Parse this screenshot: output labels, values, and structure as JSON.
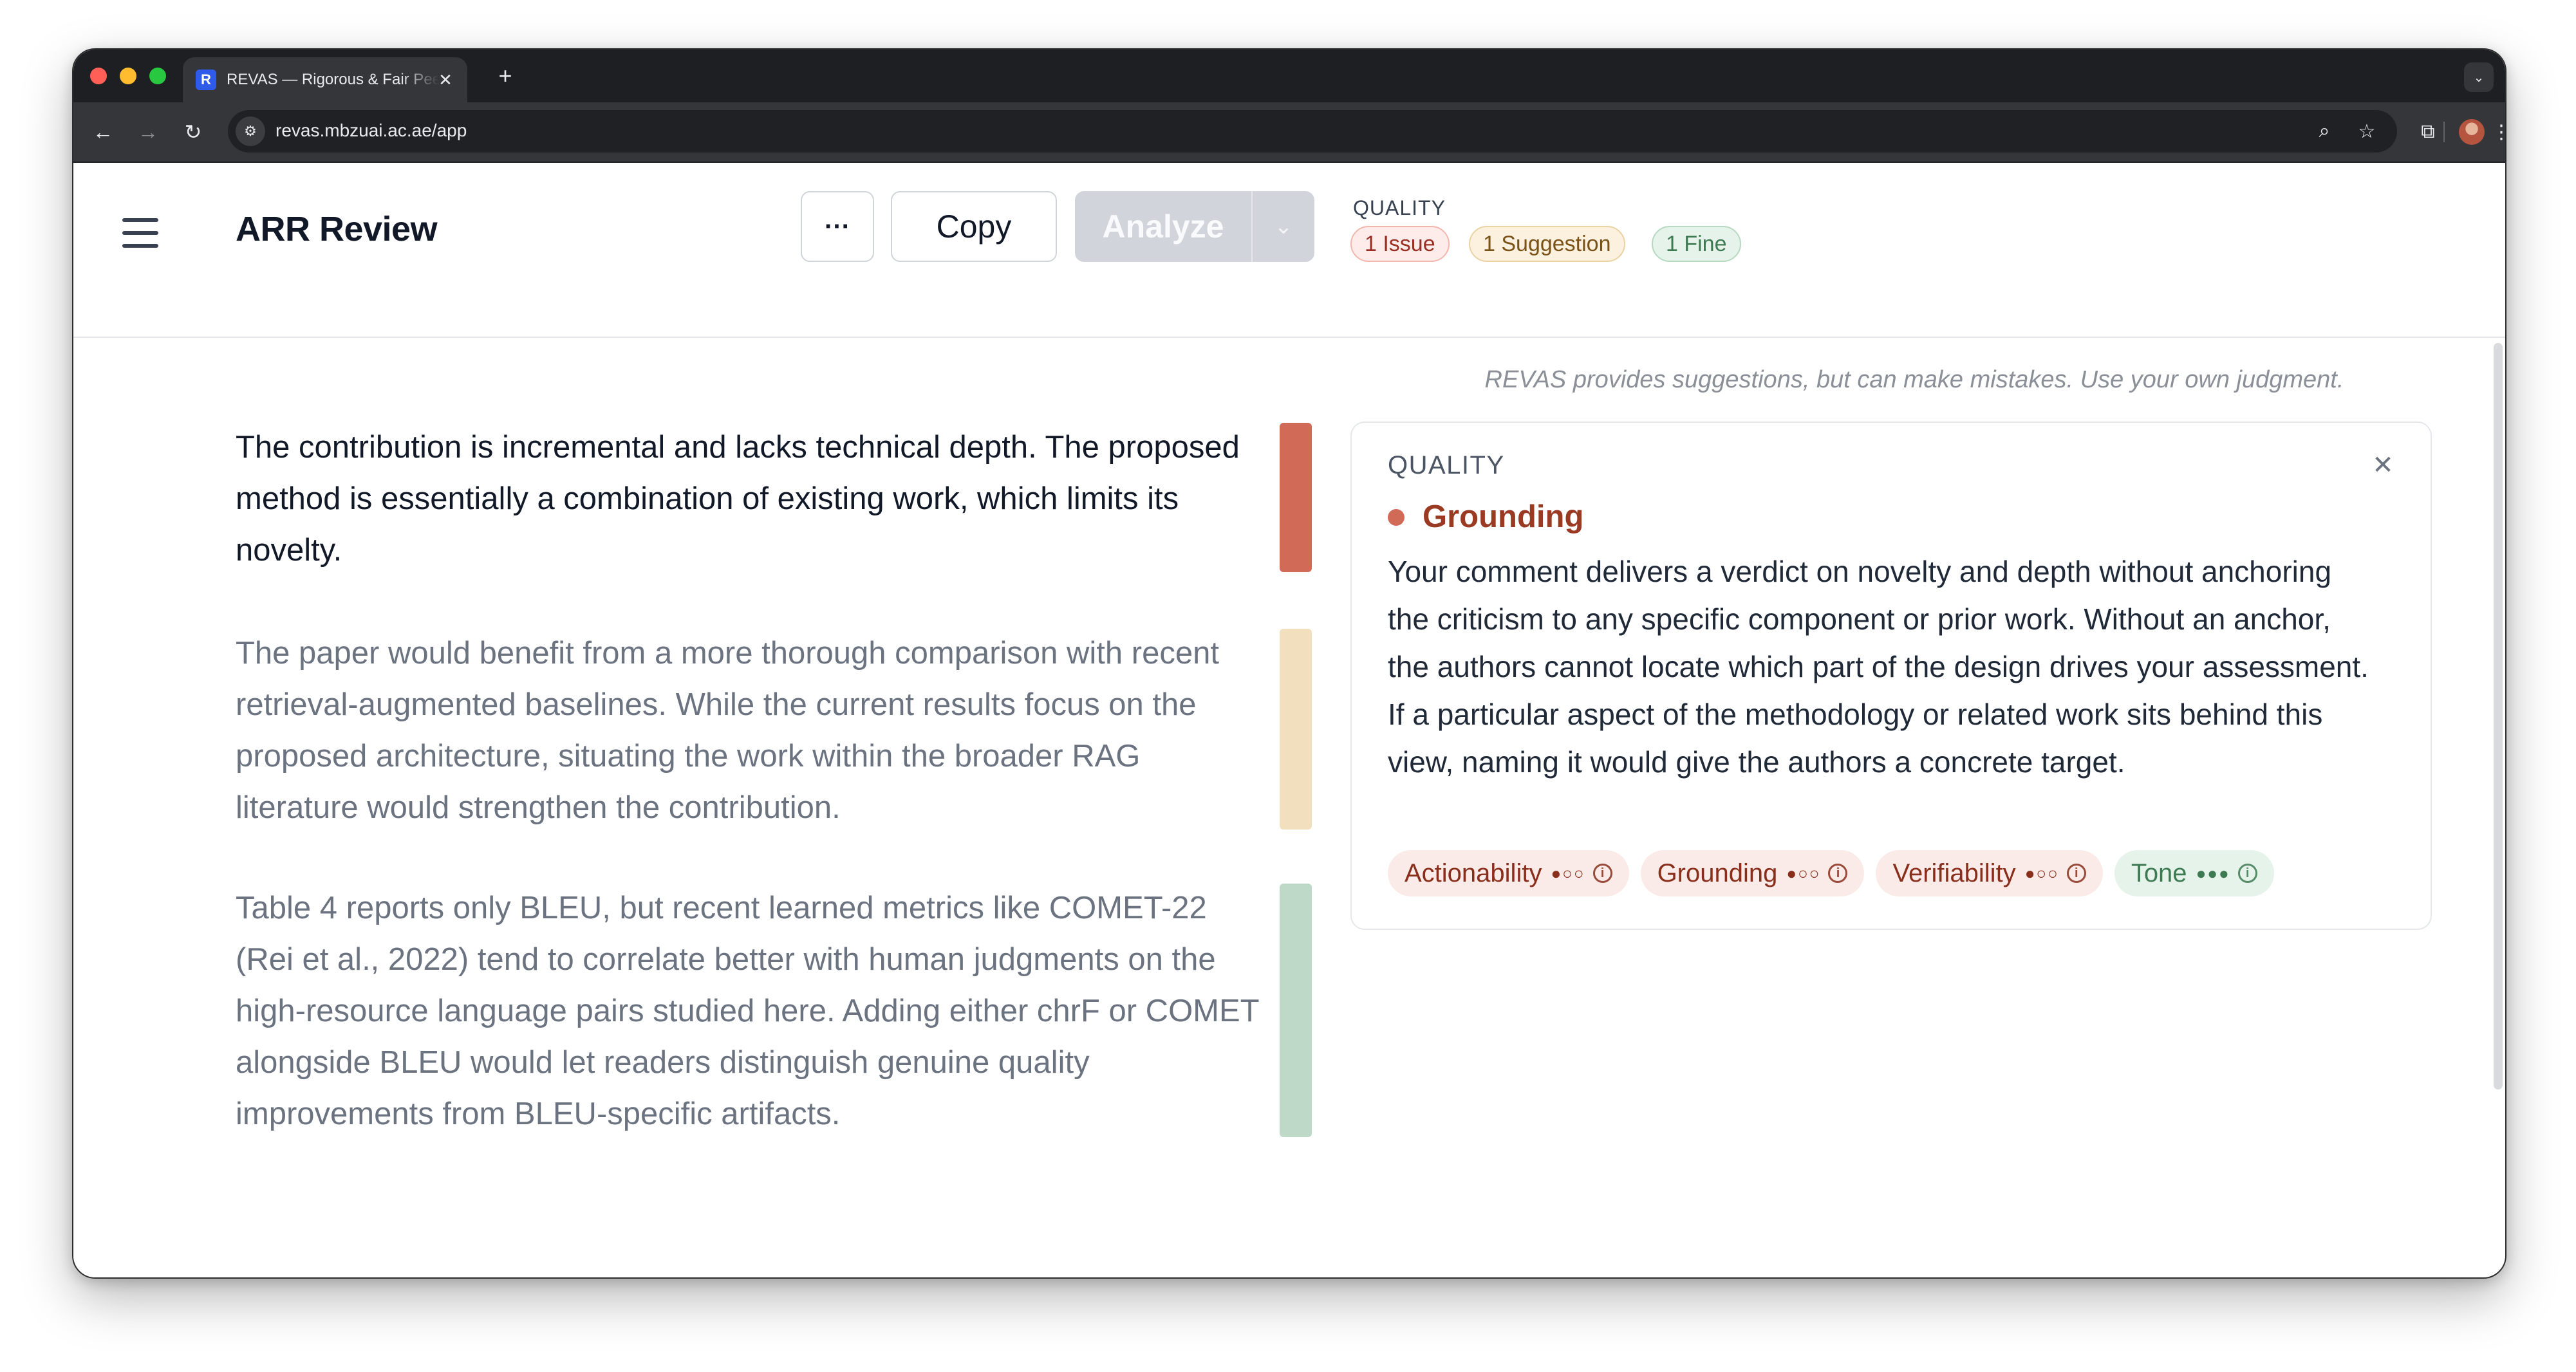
{
  "browser": {
    "tab_title": "REVAS — Rigorous & Fair Peer Review",
    "favicon_letter": "R",
    "tab_close": "✕",
    "new_tab": "+",
    "tab_menu": "⌄",
    "url": "revas.mbzuai.ac.ae/app",
    "icons": {
      "back": "←",
      "forward": "→",
      "reload": "↻",
      "site_info": "⚙",
      "zoom": "⌕",
      "bookmark": "☆",
      "extensions": "⧉",
      "menu": "⋮"
    }
  },
  "header": {
    "title": "ARR Review",
    "more_label": "···",
    "copy_label": "Copy",
    "analyze_label": "Analyze",
    "analyze_caret": "⌄",
    "quality_label": "QUALITY",
    "pills": {
      "issue": "1 Issue",
      "suggestion": "1 Suggestion",
      "fine": "1 Fine"
    }
  },
  "review": {
    "paragraphs": [
      {
        "text": "The contribution is incremental and lacks technical depth. The proposed method is essentially a combination of existing work, which limits its novelty.",
        "status": "issue"
      },
      {
        "text": "The paper would benefit from a more thorough comparison with recent retrieval-augmented baselines. While the current results focus on the proposed architecture, situating the work within the broader RAG literature would strengthen the contribution.",
        "status": "suggestion"
      },
      {
        "text": "Table 4 reports only BLEU, but recent learned metrics like COMET-22 (Rei et al., 2022) tend to correlate better with human judgments on the high-resource language pairs studied here. Adding either chrF or COMET alongside BLEU would let readers distinguish genuine quality improvements from BLEU-specific artifacts.",
        "status": "fine"
      }
    ]
  },
  "panel": {
    "disclaimer": "REVAS provides suggestions, but can make mistakes. Use your own judgment.",
    "card": {
      "label": "QUALITY",
      "close": "✕",
      "heading": "Grounding",
      "body": "Your comment delivers a verdict on novelty and depth without anchoring the criticism to any specific component or prior work. Without an anchor, the authors cannot locate which part of the design drives your assessment. If a particular aspect of the methodology or related work sits behind this view, naming it would give the authors a concrete target.",
      "chips": [
        {
          "label": "Actionability",
          "dots": "●○○",
          "info": "i"
        },
        {
          "label": "Grounding",
          "dots": "●○○",
          "info": "i"
        },
        {
          "label": "Verifiability",
          "dots": "●○○",
          "info": "i"
        },
        {
          "label": "Tone",
          "dots": "●●●",
          "info": "i"
        }
      ]
    }
  },
  "colors": {
    "issue": "#d16b58",
    "suggestion": "#f1dfbe",
    "fine": "#bfd9c9"
  }
}
